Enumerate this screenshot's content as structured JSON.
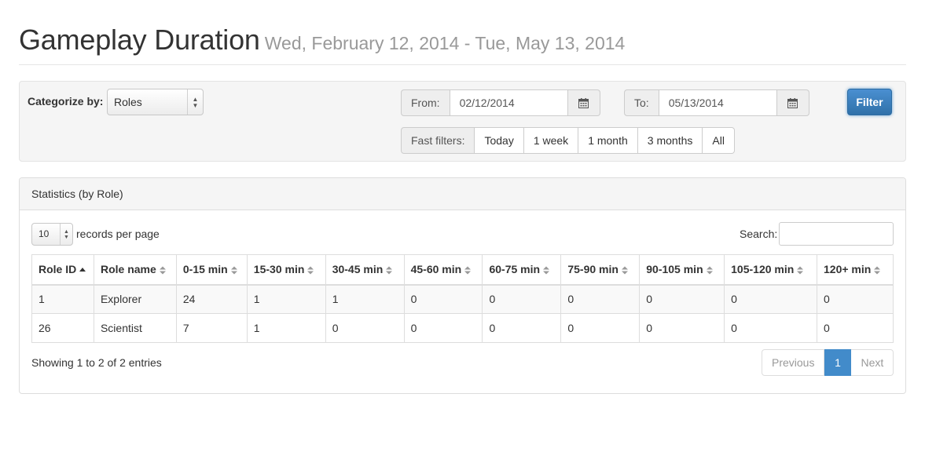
{
  "header": {
    "title": "Gameplay Duration",
    "date_range": "Wed, February 12, 2014 - Tue, May 13, 2014"
  },
  "filters": {
    "categorize_label": "Categorize by:",
    "categorize_value": "Roles",
    "from_label": "From:",
    "from_value": "02/12/2014",
    "to_label": "To:",
    "to_value": "05/13/2014",
    "filter_button": "Filter",
    "fast_filters_label": "Fast filters:",
    "fast_filters": [
      "Today",
      "1 week",
      "1 month",
      "3 months",
      "All"
    ]
  },
  "panel": {
    "heading": "Statistics (by Role)",
    "page_length": "10",
    "page_length_label": "records per page",
    "search_label": "Search:",
    "search_value": "",
    "columns": [
      "Role ID",
      "Role name",
      "0-15 min",
      "15-30 min",
      "30-45 min",
      "45-60 min",
      "60-75 min",
      "75-90 min",
      "90-105 min",
      "105-120 min",
      "120+ min"
    ],
    "sorted_column": "Role ID",
    "rows": [
      [
        "1",
        "Explorer",
        "24",
        "1",
        "1",
        "0",
        "0",
        "0",
        "0",
        "0",
        "0"
      ],
      [
        "26",
        "Scientist",
        "7",
        "1",
        "0",
        "0",
        "0",
        "0",
        "0",
        "0",
        "0"
      ]
    ],
    "info": "Showing 1 to 2 of 2 entries",
    "pagination": {
      "previous": "Previous",
      "current": "1",
      "next": "Next"
    }
  },
  "colors": {
    "primary": "#428bca",
    "muted": "#999999"
  }
}
